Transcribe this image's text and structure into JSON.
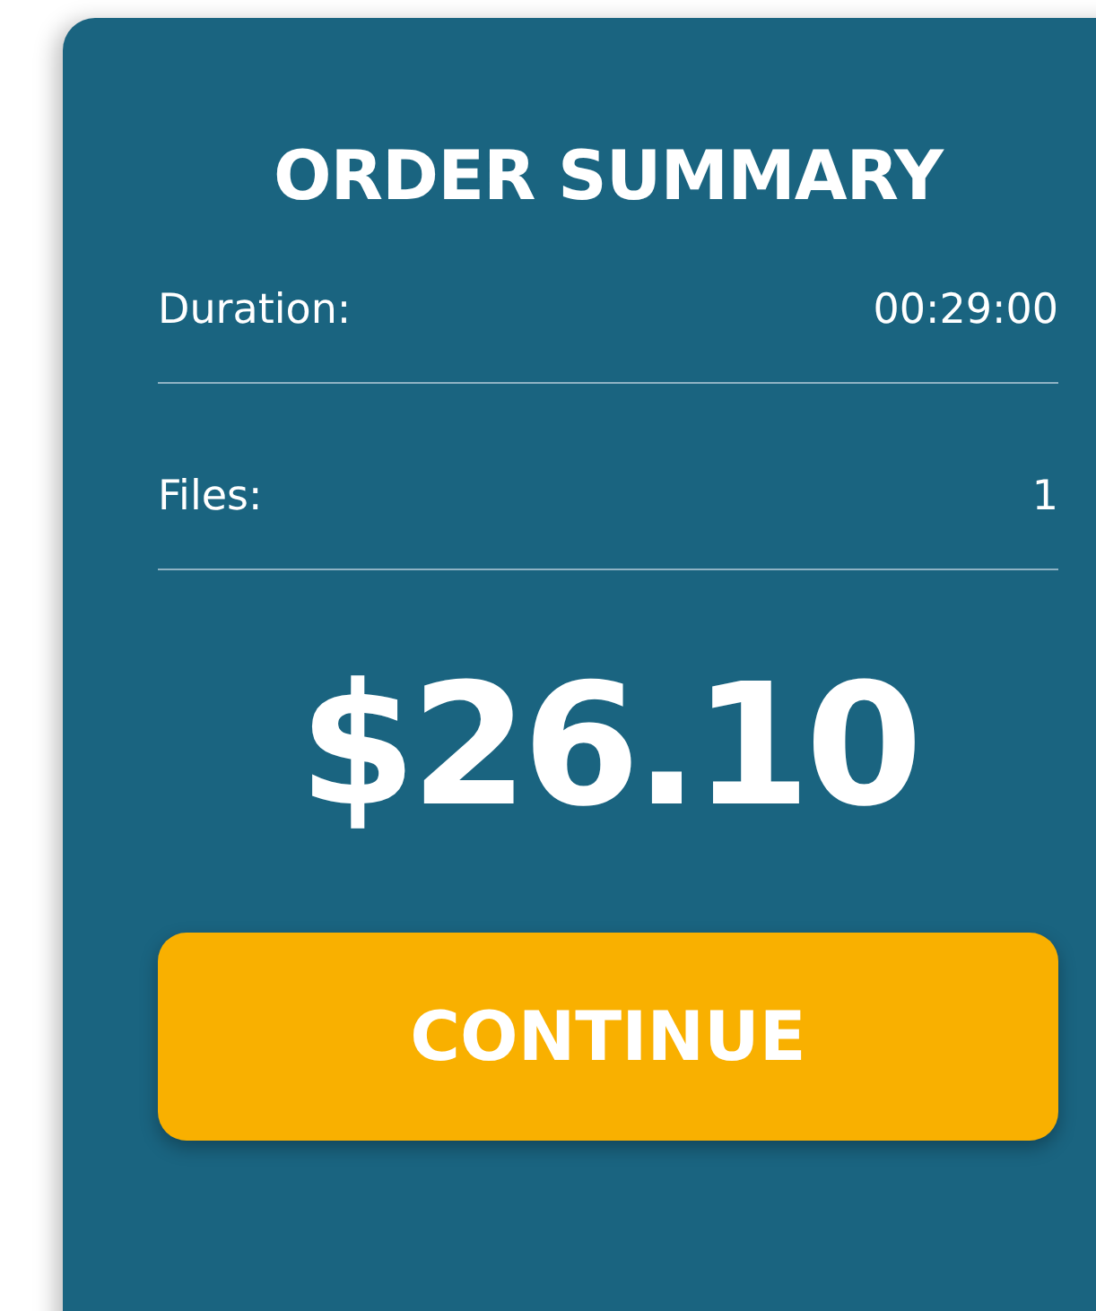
{
  "title": "ORDER SUMMARY",
  "rows": [
    {
      "label": "Duration:",
      "value": "00:29:00"
    },
    {
      "label": "Files:",
      "value": "1"
    }
  ],
  "price": "$26.10",
  "button": "CONTINUE"
}
